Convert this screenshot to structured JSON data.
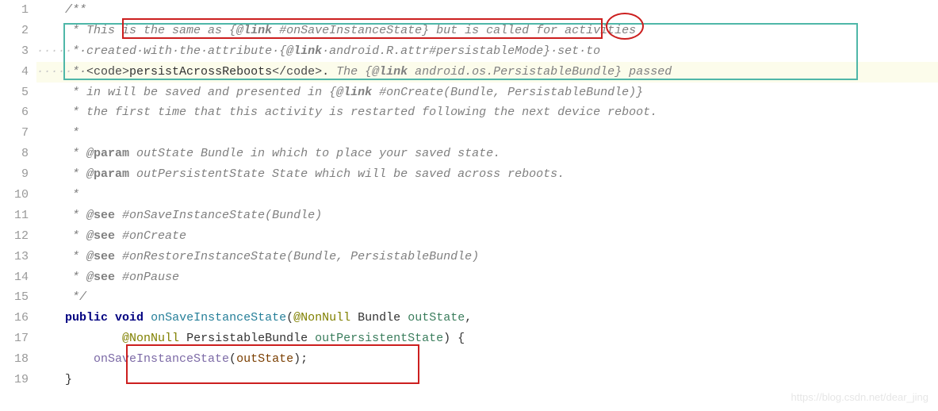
{
  "gutter": [
    "1",
    "2",
    "3",
    "4",
    "5",
    "6",
    "7",
    "8",
    "9",
    "10",
    "11",
    "12",
    "13",
    "14",
    "15",
    "16",
    "17",
    "18",
    "19"
  ],
  "lines": {
    "l1": {
      "pre": "    ",
      "star": "/**"
    },
    "l2": {
      "pre": "     * ",
      "t1": "This is the same as {@",
      "t_link": "link",
      "t2": " #onSaveInstanceState} but is called for activities"
    },
    "l3": {
      "dots": "·····",
      "star": "*·",
      "t1": "created·with·the·attribute·{@",
      "t_link": "link",
      "t2": "·android.R.attr#persistableMode}·set·to"
    },
    "l4": {
      "dots": "·····",
      "star": "*·",
      "co": "<code>",
      "ct": "persistAcrossReboots",
      "cc": "</code>",
      "p": ".",
      "t1": " The {@",
      "t_link": "link",
      "t2": " android.os.PersistableBundle} passed"
    },
    "l5": {
      "pre": "     * ",
      "t": "in will be saved and presented in {@",
      "t_link": "link",
      "t2": " #onCreate(Bundle, PersistableBundle)}"
    },
    "l6": {
      "pre": "     * ",
      "t": "the first time that this activity is restarted following the next device reboot."
    },
    "l7": {
      "pre": "     *"
    },
    "l8": {
      "pre": "     * @",
      "tag": "param",
      "t": " outState Bundle in which to place your saved state."
    },
    "l9": {
      "pre": "     * @",
      "tag": "param",
      "t": " outPersistentState State which will be saved across reboots."
    },
    "l10": {
      "pre": "     *"
    },
    "l11": {
      "pre": "     * @",
      "tag": "see",
      "t": " #onSaveInstanceState(Bundle)"
    },
    "l12": {
      "pre": "     * @",
      "tag": "see",
      "t": " #onCreate"
    },
    "l13": {
      "pre": "     * @",
      "tag": "see",
      "t": " #onRestoreInstanceState(Bundle, PersistableBundle)"
    },
    "l14": {
      "pre": "     * @",
      "tag": "see",
      "t": " #onPause"
    },
    "l15": {
      "pre": "     ",
      "t": "*/"
    },
    "l16": {
      "pre": "    ",
      "kw": "public",
      "sp": " ",
      "ret": "void",
      "sp2": " ",
      "m": "onSaveInstanceState",
      "p1": "(",
      "a1": "@NonNull",
      "sp3": " ",
      "t1": "Bundle",
      "sp4": " ",
      "pn1": "outState",
      "c": ","
    },
    "l17": {
      "pre": "            ",
      "a1": "@NonNull",
      "sp": " ",
      "t1": "PersistableBundle",
      "sp2": " ",
      "pn1": "outPersistentState",
      "p": ") {"
    },
    "l18": {
      "pre": "        ",
      "m": "onSaveInstanceState",
      "p1": "(",
      "pn": "outState",
      "p2": ");"
    },
    "l19": {
      "pre": "    ",
      "t": "}"
    }
  },
  "watermark": "https://blog.csdn.net/dear_jing"
}
